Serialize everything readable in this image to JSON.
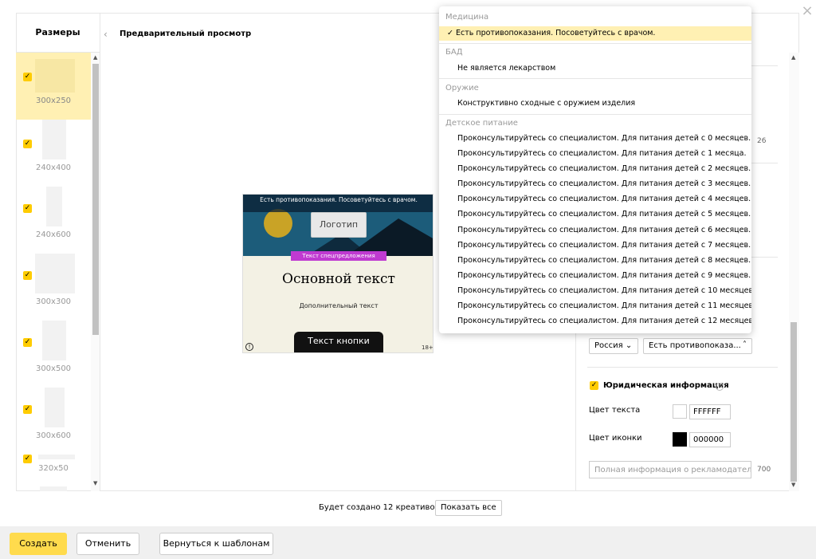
{
  "sizes": {
    "title": "Размеры",
    "items": [
      {
        "label": "300x250",
        "checked": true,
        "active": true
      },
      {
        "label": "240x400",
        "checked": true
      },
      {
        "label": "240x600",
        "checked": true
      },
      {
        "label": "300x300",
        "checked": true
      },
      {
        "label": "300x500",
        "checked": true
      },
      {
        "label": "300x600",
        "checked": true
      },
      {
        "label": "320x50",
        "checked": true
      }
    ]
  },
  "preview": {
    "title": "Предварительный просмотр",
    "banner": {
      "warning": "Есть противопоказания. Посоветуйтесь с врачом.",
      "logo": "Логотип",
      "promo": "Текст спецпредложения",
      "main_text": "Основной текст",
      "sub_text": "Дополнительный текст",
      "button": "Текст кнопки",
      "info_icon": "!",
      "age": "18+"
    }
  },
  "dropdown": {
    "groups": [
      {
        "title": "Медицина",
        "options": [
          {
            "label": "Есть противопоказания. Посоветуйтесь с врачом.",
            "selected": true
          }
        ]
      },
      {
        "title": "БАД",
        "options": [
          {
            "label": "Не является лекарством"
          }
        ]
      },
      {
        "title": "Оружие",
        "options": [
          {
            "label": "Конструктивно сходные с оружием изделия"
          }
        ]
      },
      {
        "title": "Детское питание",
        "options": [
          {
            "label": "Проконсультируйтесь со специалистом. Для питания детей с 0 месяцев."
          },
          {
            "label": "Проконсультируйтесь со специалистом. Для питания детей с 1 месяца."
          },
          {
            "label": "Проконсультируйтесь со специалистом. Для питания детей с 2 месяцев."
          },
          {
            "label": "Проконсультируйтесь со специалистом. Для питания детей с 3 месяцев."
          },
          {
            "label": "Проконсультируйтесь со специалистом. Для питания детей с 4 месяцев."
          },
          {
            "label": "Проконсультируйтесь со специалистом. Для питания детей с 5 месяцев."
          },
          {
            "label": "Проконсультируйтесь со специалистом. Для питания детей с 6 месяцев."
          },
          {
            "label": "Проконсультируйтесь со специалистом. Для питания детей с 7 месяцев."
          },
          {
            "label": "Проконсультируйтесь со специалистом. Для питания детей с 8 месяцев."
          },
          {
            "label": "Проконсультируйтесь со специалистом. Для питания детей с 9 месяцев."
          },
          {
            "label": "Проконсультируйтесь со специалистом. Для питания детей с 10 месяцев."
          },
          {
            "label": "Проконсультируйтесь со специалистом. Для питания детей с 11 месяцев."
          },
          {
            "label": "Проконсультируйтесь со специалистом. Для питания детей с 12 месяцев."
          }
        ]
      }
    ]
  },
  "settings": {
    "counter": "26",
    "country_select": "Россия",
    "warning_select": "Есть противопоказа...",
    "legal": {
      "label": "Юридическая информация",
      "text_color_label": "Цвет текста",
      "text_color_value": "FFFFFF",
      "text_color": "#ffffff",
      "icon_color_label": "Цвет иконки",
      "icon_color_value": "000000",
      "icon_color": "#000000",
      "info_placeholder": "Полная информация о рекламодателе",
      "info_limit": "700"
    }
  },
  "footer": {
    "count_text": "Будет создано 12 креативов",
    "show_all": "Показать все",
    "create": "Создать",
    "cancel": "Отменить",
    "back_to_templates": "Вернуться к шаблонам"
  },
  "colors": {
    "accent": "#ffdb4d",
    "checkbox": "#ffcc00",
    "active_item": "#fff0b3",
    "promo": "#c03ad1"
  }
}
